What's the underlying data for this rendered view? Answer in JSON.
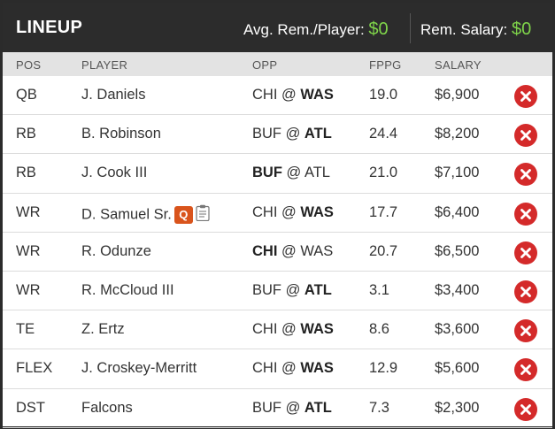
{
  "header": {
    "title": "LINEUP",
    "avg_label": "Avg. Rem./Player:",
    "avg_value": "$0",
    "rem_label": "Rem. Salary:",
    "rem_value": "$0"
  },
  "columns": {
    "pos": "POS",
    "player": "PLAYER",
    "opp": "OPP",
    "fppg": "FPPG",
    "salary": "SALARY"
  },
  "rows": [
    {
      "pos": "QB",
      "player": "J. Daniels",
      "opp_away": "CHI",
      "opp_sep": " @ ",
      "opp_home": "WAS",
      "bold": "home",
      "fppg": "19.0",
      "salary": "$6,900"
    },
    {
      "pos": "RB",
      "player": "B. Robinson",
      "opp_away": "BUF",
      "opp_sep": " @ ",
      "opp_home": "ATL",
      "bold": "home",
      "fppg": "24.4",
      "salary": "$8,200"
    },
    {
      "pos": "RB",
      "player": "J. Cook III",
      "opp_away": "BUF",
      "opp_sep": " @ ",
      "opp_home": "ATL",
      "bold": "away",
      "fppg": "21.0",
      "salary": "$7,100"
    },
    {
      "pos": "WR",
      "player": "D. Samuel Sr.",
      "badge": "Q",
      "note": true,
      "opp_away": "CHI",
      "opp_sep": " @ ",
      "opp_home": "WAS",
      "bold": "home",
      "fppg": "17.7",
      "salary": "$6,400"
    },
    {
      "pos": "WR",
      "player": "R. Odunze",
      "opp_away": "CHI",
      "opp_sep": " @ ",
      "opp_home": "WAS",
      "bold": "away",
      "fppg": "20.7",
      "salary": "$6,500"
    },
    {
      "pos": "WR",
      "player": "R. McCloud III",
      "opp_away": "BUF",
      "opp_sep": " @ ",
      "opp_home": "ATL",
      "bold": "home",
      "fppg": "3.1",
      "salary": "$3,400"
    },
    {
      "pos": "TE",
      "player": "Z. Ertz",
      "opp_away": "CHI",
      "opp_sep": " @ ",
      "opp_home": "WAS",
      "bold": "home",
      "fppg": "8.6",
      "salary": "$3,600"
    },
    {
      "pos": "FLEX",
      "player": "J. Croskey-Merritt",
      "opp_away": "CHI",
      "opp_sep": " @ ",
      "opp_home": "WAS",
      "bold": "home",
      "fppg": "12.9",
      "salary": "$5,600"
    },
    {
      "pos": "DST",
      "player": "Falcons",
      "opp_away": "BUF",
      "opp_sep": " @ ",
      "opp_home": "ATL",
      "bold": "home",
      "fppg": "7.3",
      "salary": "$2,300"
    }
  ],
  "colors": {
    "header_bg": "#2c2c2c",
    "money_green": "#7fd44a",
    "remove_red": "#d42a2a",
    "injury_orange": "#d9541c"
  },
  "icons": {
    "remove": "remove-x-circle-icon",
    "injury": "questionable-badge-icon",
    "note": "player-note-icon"
  }
}
